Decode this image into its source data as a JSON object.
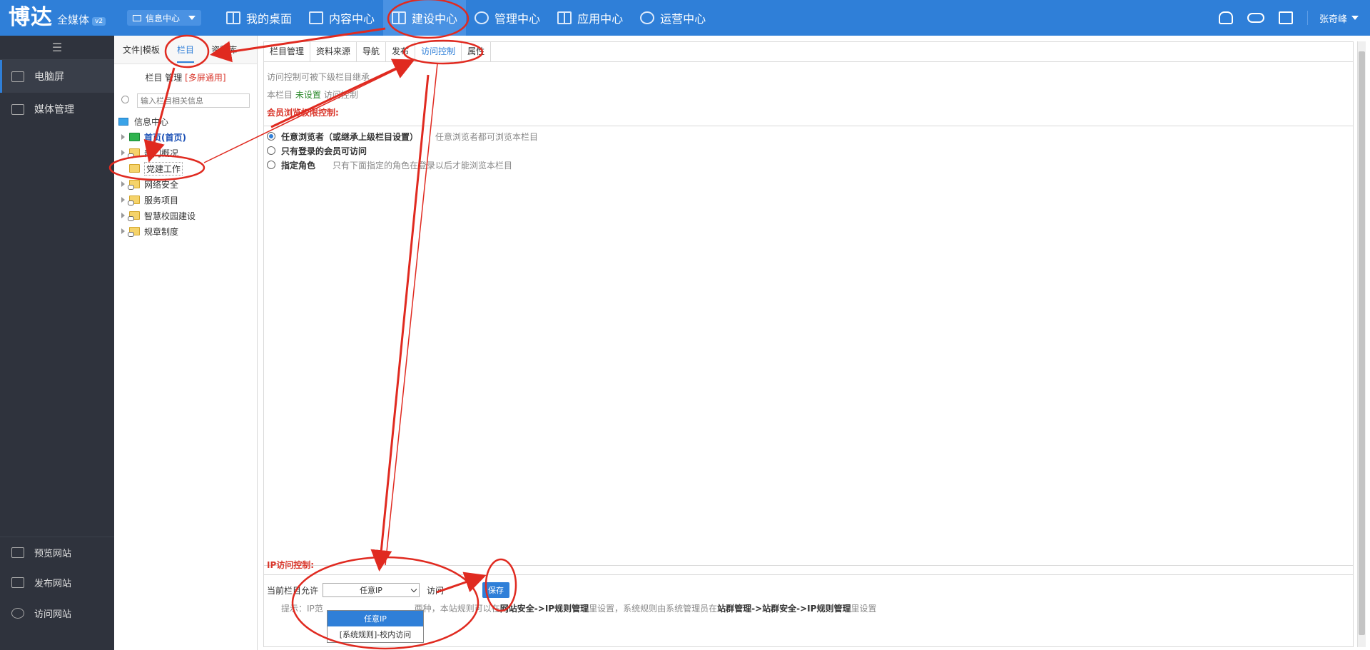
{
  "topbar": {
    "logo_main": "博达",
    "logo_sub": "全媒体",
    "logo_version": "v2",
    "site_select": "信息中心",
    "nav": [
      {
        "label": "我的桌面",
        "icon": "desktop-grid-icon"
      },
      {
        "label": "内容中心",
        "icon": "document-icon"
      },
      {
        "label": "建设中心",
        "icon": "build-grid-icon"
      },
      {
        "label": "管理中心",
        "icon": "gear-icon"
      },
      {
        "label": "应用中心",
        "icon": "apps-icon"
      },
      {
        "label": "运营中心",
        "icon": "pie-chart-icon"
      }
    ],
    "active_nav": "建设中心",
    "user_name": "张奇峰"
  },
  "sidebar": {
    "items": [
      {
        "label": "电脑屏",
        "icon": "monitor-icon"
      },
      {
        "label": "媒体管理",
        "icon": "media-icon"
      }
    ],
    "bottom_items": [
      {
        "label": "预览网站",
        "icon": "preview-icon"
      },
      {
        "label": "发布网站",
        "icon": "publish-icon"
      },
      {
        "label": "访问网站",
        "icon": "globe-icon"
      }
    ]
  },
  "tree_panel": {
    "tabs": [
      "文件|模板",
      "栏目",
      "资料库"
    ],
    "title": "栏目 管理",
    "title_tag": "[多屏通用]",
    "search_placeholder": "输入栏目相关信息",
    "root": "信息中心",
    "children": [
      {
        "label": "首页(首页)"
      },
      {
        "label": "部门概况"
      },
      {
        "label": "党建工作"
      },
      {
        "label": "网络安全"
      },
      {
        "label": "服务项目"
      },
      {
        "label": "智慧校园建设"
      },
      {
        "label": "规章制度"
      }
    ]
  },
  "main": {
    "tabs": [
      "栏目管理",
      "资料来源",
      "导航",
      "发布",
      "访问控制",
      "属性"
    ],
    "active_tab": "访问控制",
    "inherit_note": "访问控制可被下级栏目继承",
    "status_prefix": "本栏目",
    "status_value": "未设置",
    "status_suffix": "访问控制",
    "member_title": "会员浏览权限控制:",
    "options": [
      {
        "label": "任意浏览者（或继承上级栏目设置）",
        "hint": "任意浏览者都可浏览本栏目"
      },
      {
        "label": "只有登录的会员可访问",
        "hint": ""
      },
      {
        "label": "指定角色",
        "hint": "只有下面指定的角色在登录以后才能浏览本栏目"
      }
    ],
    "ip_title": "IP访问控制:",
    "ip_label_before": "当前栏目允许",
    "ip_selected": "任意IP",
    "ip_label_after": "访问",
    "save_label": "保存",
    "hint_a": "提示：IP范",
    "hint_b": "两种，本站规则可以在",
    "hint_c": "网站安全->IP规则管理",
    "hint_d": "里设置，系统规则由系统管理员在",
    "hint_e": "站群管理->站群安全->IP规则管理",
    "hint_f": "里设置",
    "dropdown_options": [
      "任意IP",
      "[系统规则]-校内访问"
    ]
  }
}
